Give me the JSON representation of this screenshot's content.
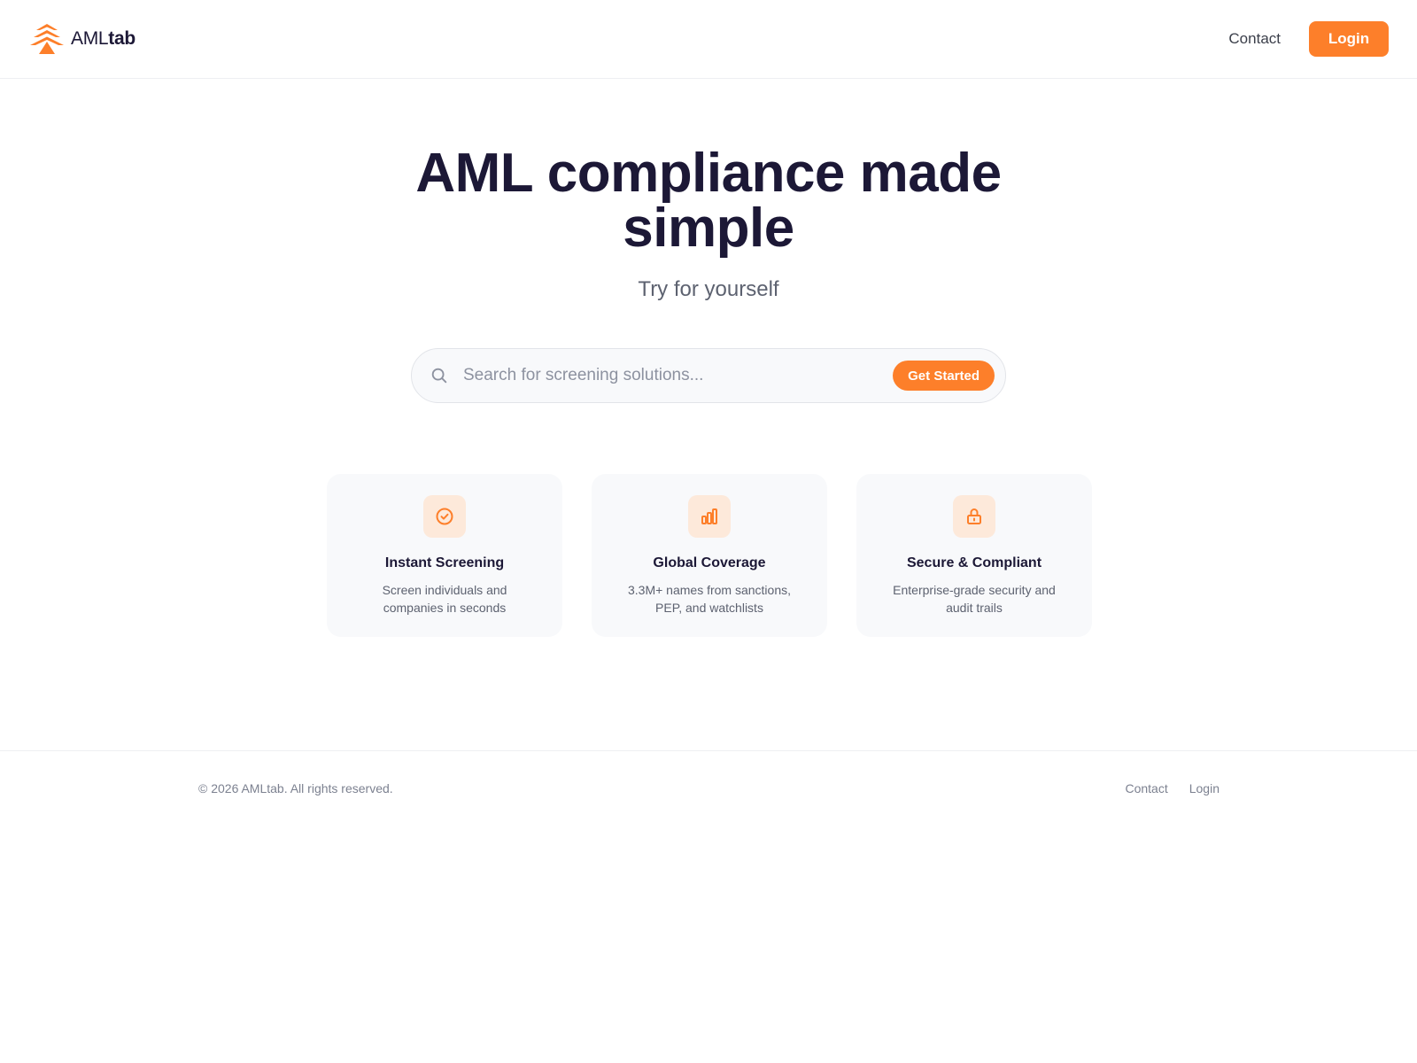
{
  "brand": {
    "name_light": "AML",
    "name_bold": "tab",
    "icon": "tree-logo-icon",
    "accent_color": "#fd7f2a"
  },
  "header": {
    "nav": {
      "contact_label": "Contact",
      "login_label": "Login"
    }
  },
  "hero": {
    "title": "AML compliance made simple",
    "subtitle": "Try for yourself"
  },
  "search": {
    "icon": "search-icon",
    "value": "",
    "placeholder": "Search for screening solutions...",
    "button_label": "Get Started"
  },
  "features": [
    {
      "icon": "check-circle-icon",
      "title": "Instant Screening",
      "description": "Screen individuals and companies in seconds"
    },
    {
      "icon": "bar-chart-icon",
      "title": "Global Coverage",
      "description": "3.3M+ names from sanctions, PEP, and watchlists"
    },
    {
      "icon": "lock-icon",
      "title": "Secure & Compliant",
      "description": "Enterprise-grade security and audit trails"
    }
  ],
  "footer": {
    "copyright": "© 2026 AMLtab. All rights reserved.",
    "links": {
      "contact_label": "Contact",
      "login_label": "Login"
    }
  }
}
